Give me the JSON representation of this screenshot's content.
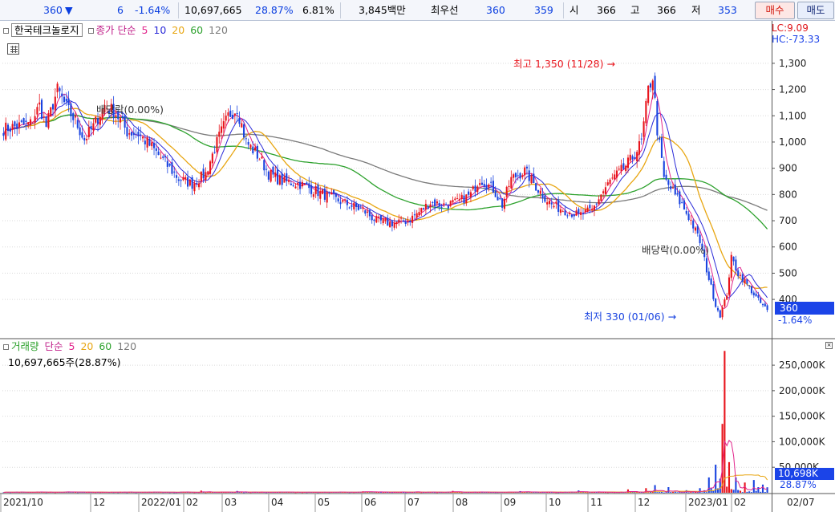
{
  "quote_bar": {
    "price": "360",
    "direction_icon": "down-triangle-icon",
    "change": "6",
    "change_pct": "-1.64%",
    "volume": "10,697,665",
    "turnover_ratio": "28.87%",
    "ratio2": "6.81%",
    "trade_value": "3,845백만",
    "best_bid_label": "최우선",
    "best_ask": "360",
    "best_bid": "359",
    "open_label": "시",
    "open": "366",
    "high_label": "고",
    "high": "366",
    "low_label": "저",
    "low": "353",
    "buy_label": "매수",
    "sell_label": "매도"
  },
  "price_panel": {
    "stock_name": "한국테크놀로지",
    "ma_prefix": "종가 단순",
    "ma_periods": [
      "5",
      "10",
      "20",
      "60",
      "120"
    ],
    "lc": "LC:9.09",
    "hc": "HC:-73.33",
    "current_price": "360",
    "current_change": "-1.64%",
    "annotations": {
      "high": "최고 1,350 (11/28)",
      "low": "최저 330 (01/06)",
      "dividend1": "배당락(0.00%)",
      "dividend2": "배당락(0.00%)"
    }
  },
  "volume_panel": {
    "title": "거래량",
    "ma_prefix": "단순",
    "ma_periods": [
      "5",
      "20",
      "60",
      "120"
    ],
    "value_text": "10,697,665주(28.87%)",
    "current_volume": "10,698K",
    "current_ratio": "28.87%"
  },
  "colors": {
    "up": "#e8141c",
    "down": "#1a44e0",
    "ma5": "#e2258c",
    "ma10": "#2a2ad8",
    "ma20": "#e8a612",
    "ma60": "#2ca12c",
    "ma120": "#7a7a7a"
  },
  "chart_data": {
    "type": "candlestick",
    "x_ticks": [
      "2021/10",
      "12",
      "2022/01",
      "02",
      "03",
      "04",
      "05",
      "06",
      "07",
      "08",
      "09",
      "10",
      "11",
      "12",
      "2023/01",
      "02",
      "02/07"
    ],
    "y_ticks": [
      400,
      500,
      600,
      700,
      800,
      900,
      1000,
      1100,
      1200,
      1300
    ],
    "y_tick_labels": [
      "400",
      "500",
      "600",
      "700",
      "800",
      "900",
      "1,000",
      "1,100",
      "1,200",
      "1,300"
    ],
    "ylim": [
      330,
      1370
    ],
    "volume_ticks": [
      50000,
      100000,
      150000,
      200000,
      250000
    ],
    "volume_tick_labels": [
      "50,000K",
      "100,000K",
      "150,000K",
      "200,000K",
      "250,000K"
    ],
    "volume_ylim": [
      0,
      280000
    ],
    "anchors": [
      [
        0,
        1050
      ],
      [
        12,
        1070
      ],
      [
        16,
        1140
      ],
      [
        19,
        1060
      ],
      [
        24,
        1200
      ],
      [
        28,
        1130
      ],
      [
        32,
        1080
      ],
      [
        36,
        1010
      ],
      [
        40,
        1060
      ],
      [
        45,
        1140
      ],
      [
        50,
        1110
      ],
      [
        55,
        1040
      ],
      [
        60,
        1030
      ],
      [
        66,
        980
      ],
      [
        72,
        920
      ],
      [
        78,
        860
      ],
      [
        84,
        840
      ],
      [
        90,
        880
      ],
      [
        95,
        1000
      ],
      [
        100,
        1100
      ],
      [
        104,
        1130
      ],
      [
        108,
        1000
      ],
      [
        114,
        940
      ],
      [
        118,
        880
      ],
      [
        124,
        850
      ],
      [
        132,
        840
      ],
      [
        140,
        810
      ],
      [
        148,
        780
      ],
      [
        154,
        760
      ],
      [
        160,
        740
      ],
      [
        166,
        700
      ],
      [
        172,
        690
      ],
      [
        180,
        700
      ],
      [
        186,
        740
      ],
      [
        190,
        770
      ],
      [
        196,
        760
      ],
      [
        202,
        770
      ],
      [
        208,
        800
      ],
      [
        212,
        860
      ],
      [
        218,
        820
      ],
      [
        222,
        760
      ],
      [
        226,
        860
      ],
      [
        232,
        890
      ],
      [
        238,
        820
      ],
      [
        244,
        760
      ],
      [
        250,
        740
      ],
      [
        256,
        720
      ],
      [
        262,
        740
      ],
      [
        266,
        800
      ],
      [
        270,
        850
      ],
      [
        276,
        900
      ],
      [
        280,
        940
      ],
      [
        284,
        1000
      ],
      [
        287,
        1200
      ],
      [
        289,
        1250
      ],
      [
        291,
        1050
      ],
      [
        294,
        860
      ],
      [
        298,
        810
      ],
      [
        302,
        760
      ],
      [
        306,
        700
      ],
      [
        310,
        620
      ],
      [
        314,
        480
      ],
      [
        317,
        380
      ],
      [
        319,
        340
      ],
      [
        322,
        420
      ],
      [
        324,
        560
      ],
      [
        327,
        500
      ],
      [
        330,
        470
      ],
      [
        334,
        420
      ],
      [
        337,
        385
      ],
      [
        340,
        360
      ]
    ],
    "volume_events": [
      [
        88,
        4200
      ],
      [
        104,
        3500
      ],
      [
        160,
        2800
      ],
      [
        200,
        3600
      ],
      [
        230,
        3200
      ],
      [
        256,
        4500
      ],
      [
        278,
        6500
      ],
      [
        286,
        9000
      ],
      [
        290,
        15000
      ],
      [
        296,
        11000
      ],
      [
        304,
        5000
      ],
      [
        310,
        9000
      ],
      [
        314,
        30000
      ],
      [
        317,
        55000
      ],
      [
        320,
        135000
      ],
      [
        321,
        278000
      ],
      [
        323,
        60000
      ],
      [
        326,
        30000
      ],
      [
        330,
        20000
      ],
      [
        334,
        25000
      ],
      [
        336,
        11000
      ],
      [
        338,
        16000
      ],
      [
        340,
        10698
      ]
    ]
  }
}
